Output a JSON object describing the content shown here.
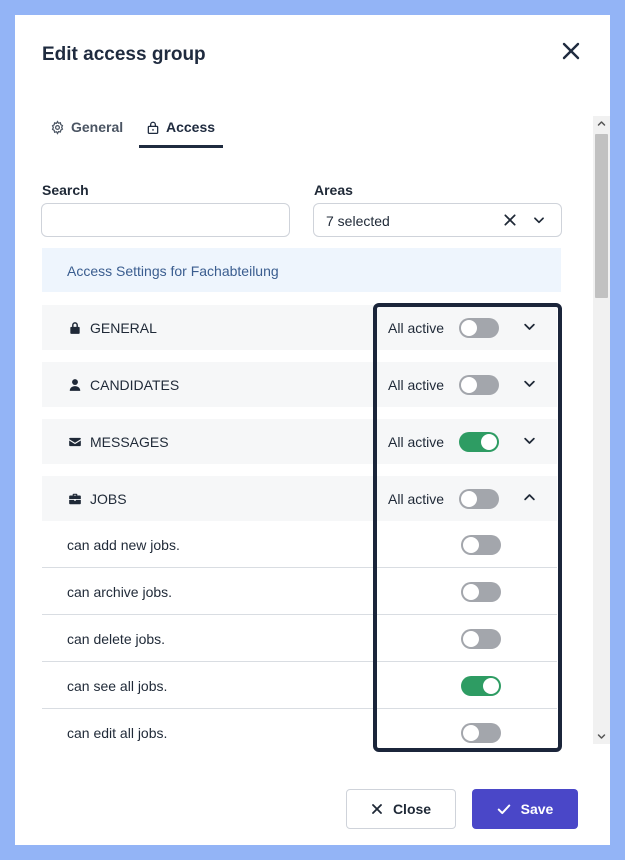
{
  "dialog": {
    "title": "Edit access group"
  },
  "tabs": [
    {
      "label": "General",
      "icon": "gear-icon",
      "active": false
    },
    {
      "label": "Access",
      "icon": "lock-icon",
      "active": true
    }
  ],
  "filters": {
    "search_label": "Search",
    "search_value": "",
    "areas_label": "Areas",
    "areas_value": "7 selected"
  },
  "info_banner": "Access Settings for Fachabteilung",
  "sections": [
    {
      "label": "GENERAL",
      "icon": "lock-icon",
      "all_label": "All active",
      "all_active": false,
      "expanded": false
    },
    {
      "label": "CANDIDATES",
      "icon": "person-icon",
      "all_label": "All active",
      "all_active": false,
      "expanded": false
    },
    {
      "label": "MESSAGES",
      "icon": "envelope-icon",
      "all_label": "All active",
      "all_active": true,
      "expanded": false
    },
    {
      "label": "JOBS",
      "icon": "briefcase-icon",
      "all_label": "All active",
      "all_active": false,
      "expanded": true
    }
  ],
  "permissions": [
    {
      "label": "can add new jobs.",
      "active": false
    },
    {
      "label": "can archive jobs.",
      "active": false
    },
    {
      "label": "can delete jobs.",
      "active": false
    },
    {
      "label": "can see all jobs.",
      "active": true
    },
    {
      "label": "can edit all jobs.",
      "active": false
    }
  ],
  "footer": {
    "close_label": "Close",
    "save_label": "Save"
  },
  "colors": {
    "backdrop": "#93b4f6",
    "toggle_on": "#2e9c63",
    "toggle_off": "#a3a6ac",
    "primary_button": "#4a47c8",
    "highlight_border": "#1b253a"
  }
}
